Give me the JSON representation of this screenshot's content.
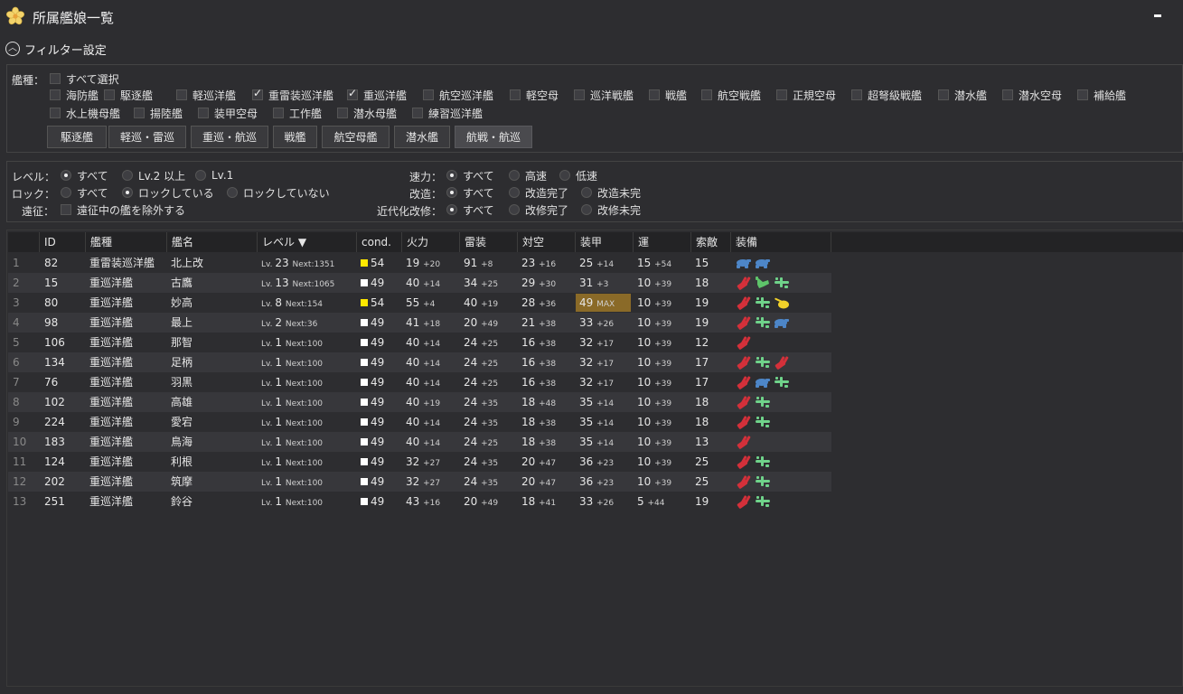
{
  "window": {
    "title": "所属艦娘一覧"
  },
  "filter": {
    "header": "フィルター設定",
    "ship_type_label": "艦種：",
    "select_all": "すべて選択",
    "ship_types": [
      {
        "label": "海防艦",
        "checked": false
      },
      {
        "label": "駆逐艦",
        "checked": false
      },
      {
        "label": "軽巡洋艦",
        "checked": false
      },
      {
        "label": "重雷装巡洋艦",
        "checked": true
      },
      {
        "label": "重巡洋艦",
        "checked": true
      },
      {
        "label": "航空巡洋艦",
        "checked": false
      },
      {
        "label": "軽空母",
        "checked": false
      },
      {
        "label": "巡洋戦艦",
        "checked": false
      },
      {
        "label": "戦艦",
        "checked": false
      },
      {
        "label": "航空戦艦",
        "checked": false
      },
      {
        "label": "正規空母",
        "checked": false
      },
      {
        "label": "超弩級戦艦",
        "checked": false
      },
      {
        "label": "潜水艦",
        "checked": false
      },
      {
        "label": "潜水空母",
        "checked": false
      },
      {
        "label": "補給艦",
        "checked": false
      },
      {
        "label": "水上機母艦",
        "checked": false
      },
      {
        "label": "揚陸艦",
        "checked": false
      },
      {
        "label": "装甲空母",
        "checked": false
      },
      {
        "label": "工作艦",
        "checked": false
      },
      {
        "label": "潜水母艦",
        "checked": false
      },
      {
        "label": "練習巡洋艦",
        "checked": false
      }
    ],
    "presets": [
      "駆逐艦",
      "軽巡・雷巡",
      "重巡・航巡",
      "戦艦",
      "航空母艦",
      "潜水艦",
      "航戦・航巡"
    ],
    "level": {
      "label": "レベル：",
      "options": [
        "すべて",
        "Lv.2 以上",
        "Lv.1"
      ],
      "selected": 0
    },
    "lock": {
      "label": "ロック：",
      "options": [
        "すべて",
        "ロックしている",
        "ロックしていない"
      ],
      "selected": 1
    },
    "expedition": {
      "label": "遠征：",
      "checkbox": "遠征中の艦を除外する",
      "checked": false
    },
    "speed": {
      "label": "速力：",
      "options": [
        "すべて",
        "高速",
        "低速"
      ],
      "selected": 0
    },
    "remodel": {
      "label": "改造：",
      "options": [
        "すべて",
        "改造完了",
        "改造未完"
      ],
      "selected": 0
    },
    "modernize": {
      "label": "近代化改修：",
      "options": [
        "すべて",
        "改修完了",
        "改修未完"
      ],
      "selected": 0
    }
  },
  "columns": [
    "ID",
    "艦種",
    "艦名",
    "レベル ▼",
    "cond.",
    "火力",
    "雷装",
    "対空",
    "装甲",
    "運",
    "索敵",
    "装備"
  ],
  "accent": {
    "cond_yellow": "#ffe800",
    "cond_white": "#ffffff",
    "max_bg": "#8a6a28"
  },
  "ships": [
    {
      "no": "1",
      "id": "82",
      "type": "重雷装巡洋艦",
      "name": "北上改",
      "lv": "23",
      "next": "Next:1351",
      "cond": "54",
      "cond_color": "yellow",
      "fp": "19",
      "fp_p": "+20",
      "tp": "91",
      "tp_p": "+8",
      "aa": "23",
      "aa_p": "+16",
      "ar": "25",
      "ar_p": "+14",
      "luck": "15",
      "luck_p": "+54",
      "los": "15",
      "equip": [
        "torpedo-icon",
        "torpedo-icon"
      ]
    },
    {
      "no": "2",
      "id": "15",
      "type": "重巡洋艦",
      "name": "古鷹",
      "lv": "13",
      "next": "Next:1065",
      "cond": "49",
      "cond_color": "white",
      "fp": "40",
      "fp_p": "+14",
      "tp": "34",
      "tp_p": "+25",
      "aa": "29",
      "aa_p": "+30",
      "ar": "31",
      "ar_p": "+3",
      "luck": "10",
      "luck_p": "+39",
      "los": "18",
      "equip": [
        "main-gun-icon",
        "seaplane-icon",
        "seaplane-recon-icon"
      ]
    },
    {
      "no": "3",
      "id": "80",
      "type": "重巡洋艦",
      "name": "妙高",
      "lv": "8",
      "next": "Next:154",
      "cond": "54",
      "cond_color": "yellow",
      "fp": "55",
      "fp_p": "+4",
      "tp": "40",
      "tp_p": "+19",
      "aa": "28",
      "aa_p": "+36",
      "ar": "49",
      "ar_p": "MAX",
      "ar_max": true,
      "luck": "10",
      "luck_p": "+39",
      "los": "19",
      "equip": [
        "main-gun-icon",
        "seaplane-recon-icon",
        "searchlight-icon"
      ]
    },
    {
      "no": "4",
      "id": "98",
      "type": "重巡洋艦",
      "name": "最上",
      "lv": "2",
      "next": "Next:36",
      "cond": "49",
      "cond_color": "white",
      "fp": "41",
      "fp_p": "+18",
      "tp": "20",
      "tp_p": "+49",
      "aa": "21",
      "aa_p": "+38",
      "ar": "33",
      "ar_p": "+26",
      "luck": "10",
      "luck_p": "+39",
      "los": "19",
      "equip": [
        "main-gun-icon",
        "seaplane-recon-icon",
        "torpedo-icon"
      ]
    },
    {
      "no": "5",
      "id": "106",
      "type": "重巡洋艦",
      "name": "那智",
      "lv": "1",
      "next": "Next:100",
      "cond": "49",
      "cond_color": "white",
      "fp": "40",
      "fp_p": "+14",
      "tp": "24",
      "tp_p": "+25",
      "aa": "16",
      "aa_p": "+38",
      "ar": "32",
      "ar_p": "+17",
      "luck": "10",
      "luck_p": "+39",
      "los": "12",
      "equip": [
        "main-gun-icon"
      ]
    },
    {
      "no": "6",
      "id": "134",
      "type": "重巡洋艦",
      "name": "足柄",
      "lv": "1",
      "next": "Next:100",
      "cond": "49",
      "cond_color": "white",
      "fp": "40",
      "fp_p": "+14",
      "tp": "24",
      "tp_p": "+25",
      "aa": "16",
      "aa_p": "+38",
      "ar": "32",
      "ar_p": "+17",
      "luck": "10",
      "luck_p": "+39",
      "los": "17",
      "equip": [
        "main-gun-icon",
        "seaplane-recon-icon",
        "main-gun-icon"
      ]
    },
    {
      "no": "7",
      "id": "76",
      "type": "重巡洋艦",
      "name": "羽黒",
      "lv": "1",
      "next": "Next:100",
      "cond": "49",
      "cond_color": "white",
      "fp": "40",
      "fp_p": "+14",
      "tp": "24",
      "tp_p": "+25",
      "aa": "16",
      "aa_p": "+38",
      "ar": "32",
      "ar_p": "+17",
      "luck": "10",
      "luck_p": "+39",
      "los": "17",
      "equip": [
        "main-gun-icon",
        "torpedo-icon",
        "seaplane-recon-icon"
      ]
    },
    {
      "no": "8",
      "id": "102",
      "type": "重巡洋艦",
      "name": "高雄",
      "lv": "1",
      "next": "Next:100",
      "cond": "49",
      "cond_color": "white",
      "fp": "40",
      "fp_p": "+19",
      "tp": "24",
      "tp_p": "+35",
      "aa": "18",
      "aa_p": "+48",
      "ar": "35",
      "ar_p": "+14",
      "luck": "10",
      "luck_p": "+39",
      "los": "18",
      "equip": [
        "main-gun-icon",
        "seaplane-recon-icon"
      ]
    },
    {
      "no": "9",
      "id": "224",
      "type": "重巡洋艦",
      "name": "愛宕",
      "lv": "1",
      "next": "Next:100",
      "cond": "49",
      "cond_color": "white",
      "fp": "40",
      "fp_p": "+14",
      "tp": "24",
      "tp_p": "+35",
      "aa": "18",
      "aa_p": "+38",
      "ar": "35",
      "ar_p": "+14",
      "luck": "10",
      "luck_p": "+39",
      "los": "18",
      "equip": [
        "main-gun-icon",
        "seaplane-recon-icon"
      ]
    },
    {
      "no": "10",
      "id": "183",
      "type": "重巡洋艦",
      "name": "鳥海",
      "lv": "1",
      "next": "Next:100",
      "cond": "49",
      "cond_color": "white",
      "fp": "40",
      "fp_p": "+14",
      "tp": "24",
      "tp_p": "+25",
      "aa": "18",
      "aa_p": "+38",
      "ar": "35",
      "ar_p": "+14",
      "luck": "10",
      "luck_p": "+39",
      "los": "13",
      "equip": [
        "main-gun-icon"
      ]
    },
    {
      "no": "11",
      "id": "124",
      "type": "重巡洋艦",
      "name": "利根",
      "lv": "1",
      "next": "Next:100",
      "cond": "49",
      "cond_color": "white",
      "fp": "32",
      "fp_p": "+27",
      "tp": "24",
      "tp_p": "+35",
      "aa": "20",
      "aa_p": "+47",
      "ar": "36",
      "ar_p": "+23",
      "luck": "10",
      "luck_p": "+39",
      "los": "25",
      "equip": [
        "main-gun-icon",
        "seaplane-recon-icon"
      ]
    },
    {
      "no": "12",
      "id": "202",
      "type": "重巡洋艦",
      "name": "筑摩",
      "lv": "1",
      "next": "Next:100",
      "cond": "49",
      "cond_color": "white",
      "fp": "32",
      "fp_p": "+27",
      "tp": "24",
      "tp_p": "+35",
      "aa": "20",
      "aa_p": "+47",
      "ar": "36",
      "ar_p": "+23",
      "luck": "10",
      "luck_p": "+39",
      "los": "25",
      "equip": [
        "main-gun-icon",
        "seaplane-recon-icon"
      ]
    },
    {
      "no": "13",
      "id": "251",
      "type": "重巡洋艦",
      "name": "鈴谷",
      "lv": "1",
      "next": "Next:100",
      "cond": "49",
      "cond_color": "white",
      "fp": "43",
      "fp_p": "+16",
      "tp": "20",
      "tp_p": "+49",
      "aa": "18",
      "aa_p": "+41",
      "ar": "33",
      "ar_p": "+26",
      "luck": "5",
      "luck_p": "+44",
      "los": "19",
      "equip": [
        "main-gun-icon",
        "seaplane-recon-icon"
      ]
    }
  ]
}
